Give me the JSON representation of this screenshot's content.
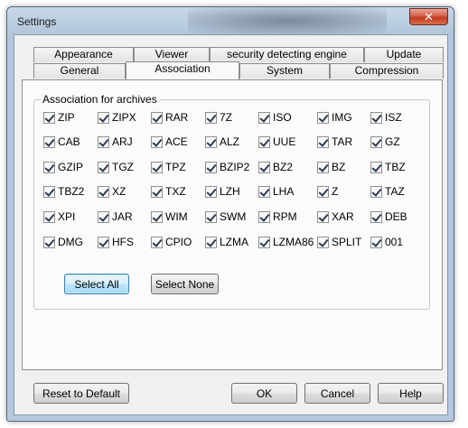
{
  "window": {
    "title": "Settings",
    "close_glyph": "✕"
  },
  "tabs_row1": [
    "Appearance",
    "Viewer",
    "security detecting engine",
    "Update"
  ],
  "tabs_row2": [
    "General",
    "Association",
    "System",
    "Compression"
  ],
  "active_tab": "Association",
  "group": {
    "label": "Association for archives"
  },
  "formats": [
    [
      "ZIP",
      "ZIPX",
      "RAR",
      "7Z",
      "ISO",
      "IMG",
      "ISZ"
    ],
    [
      "CAB",
      "ARJ",
      "ACE",
      "ALZ",
      "UUE",
      "TAR",
      "GZ"
    ],
    [
      "GZIP",
      "TGZ",
      "TPZ",
      "BZIP2",
      "BZ2",
      "BZ",
      "TBZ"
    ],
    [
      "TBZ2",
      "XZ",
      "TXZ",
      "LZH",
      "LHA",
      "Z",
      "TAZ"
    ],
    [
      "XPI",
      "JAR",
      "WIM",
      "SWM",
      "RPM",
      "XAR",
      "DEB"
    ],
    [
      "DMG",
      "HFS",
      "CPIO",
      "LZMA",
      "LZMA86",
      "SPLIT",
      "001"
    ]
  ],
  "buttons": {
    "select_all": "Select All",
    "select_none": "Select None",
    "reset": "Reset to Default",
    "ok": "OK",
    "cancel": "Cancel",
    "help": "Help"
  }
}
